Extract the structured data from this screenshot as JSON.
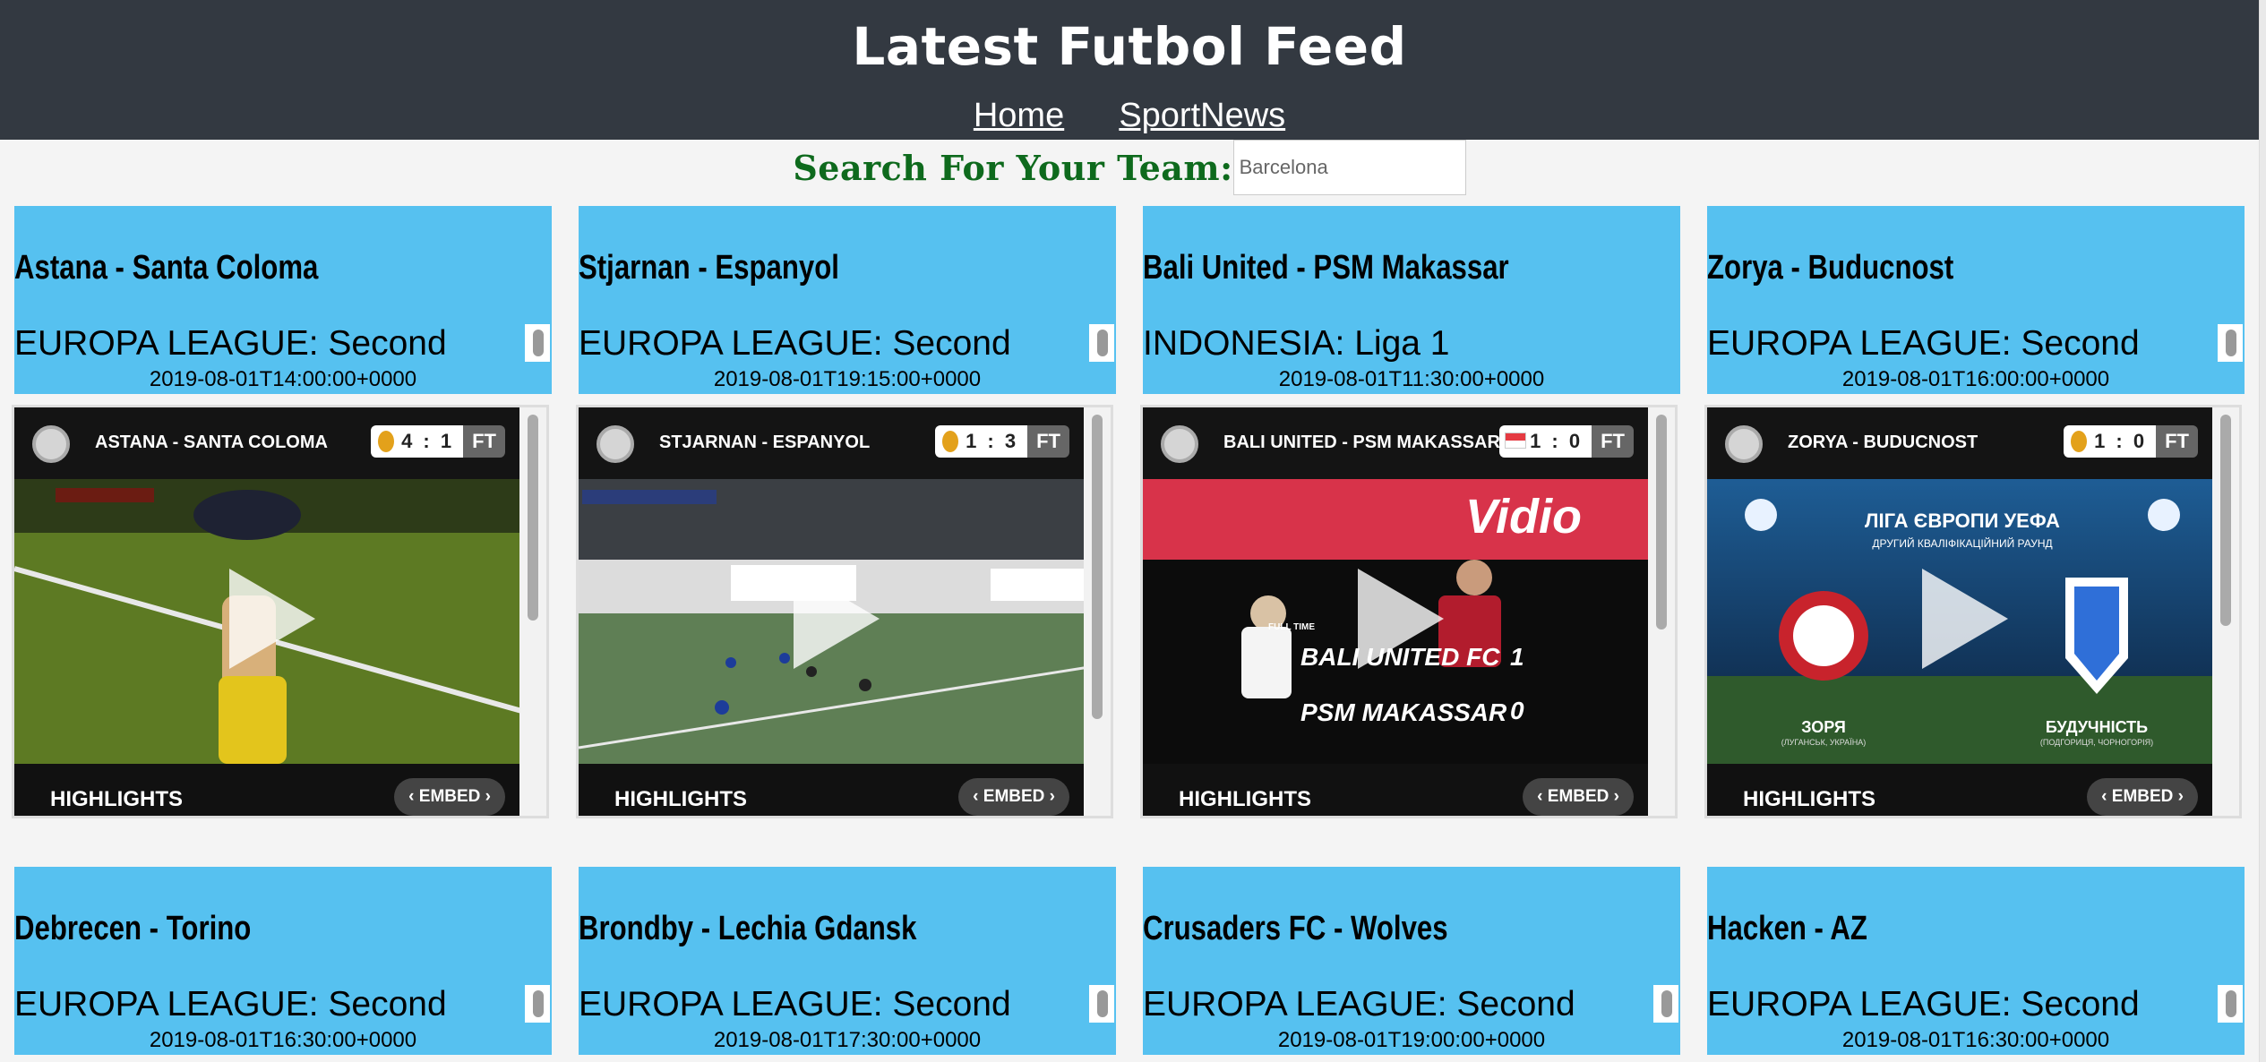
{
  "header": {
    "title": "Latest Futbol Feed",
    "nav": [
      "Home",
      "SportNews"
    ]
  },
  "search": {
    "label": "Search For Your Team:",
    "placeholder": "Barcelona"
  },
  "matches": [
    {
      "title": "Astana - Santa Coloma",
      "competition": "EUROPA LEAGUE: Second",
      "date": "2019-08-01T14:00:00+0000",
      "video": {
        "teams": "ASTANA - SANTA COLOMA",
        "score": "4 : 1",
        "status": "FT",
        "badge": "europa-league-icon",
        "highlights": "HIGHLIGHTS",
        "embed": "‹ EMBED ›",
        "scene": "pitch-celebration"
      }
    },
    {
      "title": "Stjarnan - Espanyol",
      "competition": "EUROPA LEAGUE: Second",
      "date": "2019-08-01T19:15:00+0000",
      "video": {
        "teams": "STJARNAN - ESPANYOL",
        "score": "1 : 3",
        "status": "FT",
        "badge": "europa-league-icon",
        "highlights": "HIGHLIGHTS",
        "embed": "‹ EMBED ›",
        "scene": "wide-pitch"
      }
    },
    {
      "title": "Bali United - PSM Makassar",
      "competition": "INDONESIA: Liga 1",
      "date": "2019-08-01T11:30:00+0000",
      "video": {
        "teams": "BALI UNITED - PSM MAKASSAR",
        "score": "1 : 0",
        "status": "FT",
        "badge": "indonesia-flag-icon",
        "highlights": "HIGHLIGHTS",
        "embed": "‹ EMBED ›",
        "scene": "fulltime-graphic",
        "overlay": {
          "label": "FULL TIME",
          "home": "BALI UNITED FC",
          "home_score": "1",
          "away": "PSM MAKASSAR",
          "away_score": "0",
          "banner": "Vidio"
        }
      }
    },
    {
      "title": "Zorya - Buducnost",
      "competition": "EUROPA LEAGUE: Second",
      "date": "2019-08-01T16:00:00+0000",
      "video": {
        "teams": "ZORYA - BUDUCNOST",
        "score": "1 : 0",
        "status": "FT",
        "badge": "europa-league-icon",
        "highlights": "HIGHLIGHTS",
        "embed": "‹ EMBED ›",
        "scene": "stadium-graphic",
        "overlay": {
          "heading": "ЛІГА ЄВРОПИ УЕФА",
          "sub": "ДРУГИЙ КВАЛІФІКАЦІЙНИЙ РАУНД",
          "home": "ЗОРЯ",
          "home_sub": "(ЛУГАНСЬК, УКРАЇНА)",
          "away": "БУДУЧНІСТЬ",
          "away_sub": "(ПОДГОРИЦЯ, ЧОРНОГОРІЯ)"
        }
      }
    },
    {
      "title": "Debrecen - Torino",
      "competition": "EUROPA LEAGUE: Second",
      "date": "2019-08-01T16:30:00+0000"
    },
    {
      "title": "Brondby - Lechia Gdansk",
      "competition": "EUROPA LEAGUE: Second",
      "date": "2019-08-01T17:30:00+0000"
    },
    {
      "title": "Crusaders FC - Wolves",
      "competition": "EUROPA LEAGUE: Second",
      "date": "2019-08-01T19:00:00+0000"
    },
    {
      "title": "Hacken - AZ",
      "competition": "EUROPA LEAGUE: Second",
      "date": "2019-08-01T16:30:00+0000"
    }
  ],
  "colors": {
    "header_bg": "#333941",
    "card_bg": "#56c1f0",
    "search_label": "#0e6a1d"
  }
}
